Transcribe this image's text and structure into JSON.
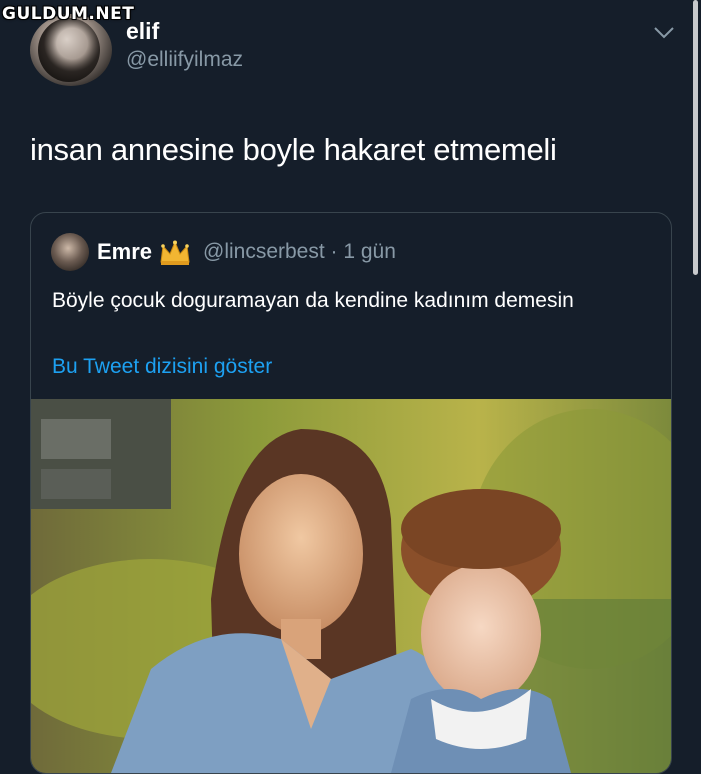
{
  "watermark": "GULDUM.NET",
  "tweet": {
    "display_name": "elif",
    "handle": "@elliifyilmaz",
    "text": "insan annesine boyle hakaret etmemeli"
  },
  "quoted_tweet": {
    "display_name": "Emre",
    "handle_time": "@lincserbest · 1 gün",
    "text": "Böyle çocuk doguramayan da kendine kadınım demesin",
    "thread_link": "Bu Tweet dizisini göster",
    "image_description": "photo"
  },
  "colors": {
    "background": "#151e2a",
    "secondary_text": "#8899a6",
    "link": "#1da1f2",
    "border": "#38444d"
  },
  "icons": [
    "chevron-down-icon",
    "crown-icon"
  ]
}
